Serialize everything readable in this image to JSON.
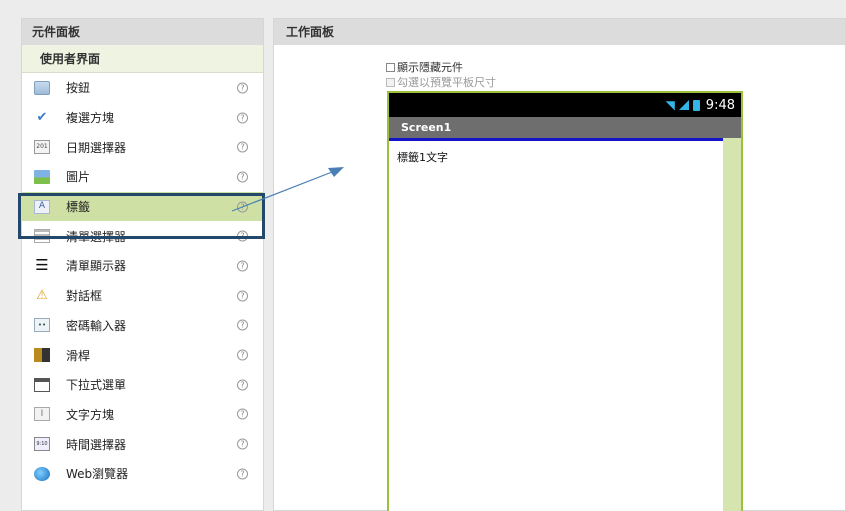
{
  "palette": {
    "header": "元件面板",
    "category": "使用者界面",
    "help_glyph": "?",
    "items": [
      {
        "label": "按鈕",
        "icon": "button-icon",
        "icon_glyph": ""
      },
      {
        "label": "複選方塊",
        "icon": "checkbox-icon",
        "icon_glyph": "✔"
      },
      {
        "label": "日期選擇器",
        "icon": "calendar-icon",
        "icon_glyph": "201"
      },
      {
        "label": "圖片",
        "icon": "image-icon",
        "icon_glyph": ""
      },
      {
        "label": "標籤",
        "icon": "label-icon",
        "icon_glyph": "A"
      },
      {
        "label": "清單選擇器",
        "icon": "list-picker-icon",
        "icon_glyph": ""
      },
      {
        "label": "清單顯示器",
        "icon": "list-view-icon",
        "icon_glyph": "☰"
      },
      {
        "label": "對話框",
        "icon": "warning-icon",
        "icon_glyph": "⚠"
      },
      {
        "label": "密碼輸入器",
        "icon": "password-icon",
        "icon_glyph": "••"
      },
      {
        "label": "滑桿",
        "icon": "slider-icon",
        "icon_glyph": ""
      },
      {
        "label": "下拉式選單",
        "icon": "spinner-icon",
        "icon_glyph": ""
      },
      {
        "label": "文字方塊",
        "icon": "textbox-icon",
        "icon_glyph": "I"
      },
      {
        "label": "時間選擇器",
        "icon": "clock-icon",
        "icon_glyph": "9:10"
      },
      {
        "label": "Web瀏覽器",
        "icon": "web-viewer-icon",
        "icon_glyph": ""
      }
    ]
  },
  "workspace": {
    "header": "工作面板",
    "show_hidden_label": "顯示隱藏元件",
    "tablet_preview_label": "勾選以預覽平板尺寸",
    "phone": {
      "clock": "9:48",
      "screen_title": "Screen1",
      "label_text": "標籤1文字"
    }
  },
  "colors": {
    "selected_item": "#cfe0a4",
    "highlight_box": "#24486b",
    "phone_border": "#9bc13c",
    "status_icons": "#33b5e5",
    "arrow": "#4a7fb5"
  }
}
